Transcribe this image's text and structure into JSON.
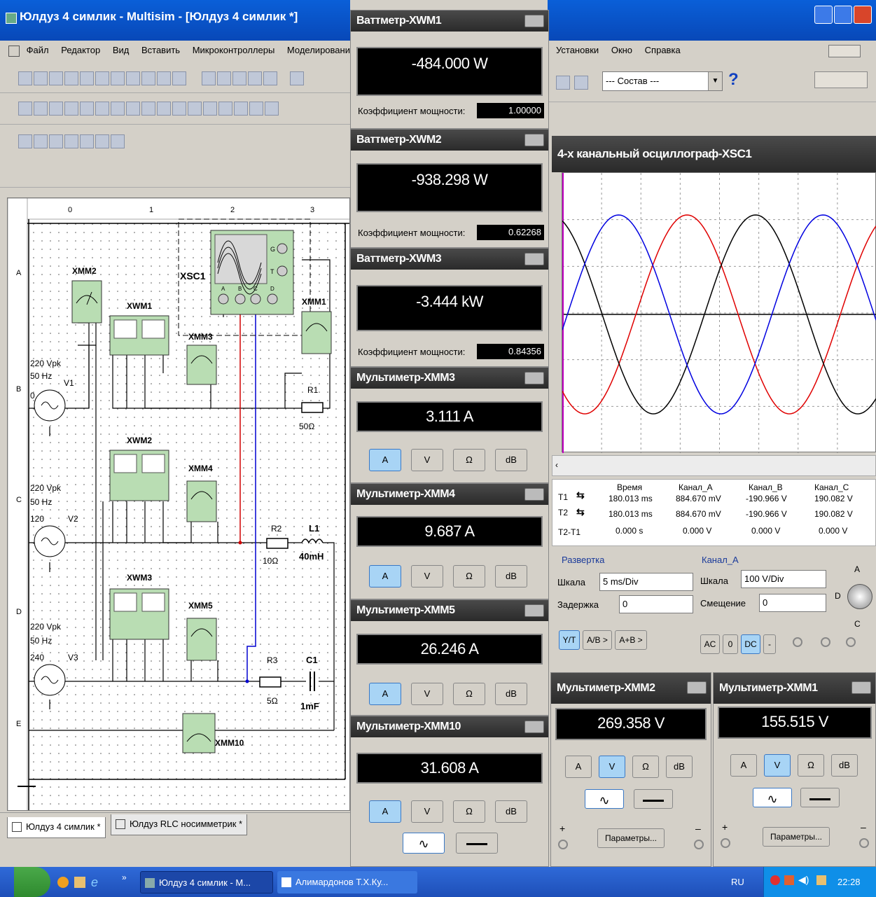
{
  "window": {
    "title": "Юлдуз 4 симлик - Multisim - [Юлдуз 4 симлик *]"
  },
  "menu": [
    "Файл",
    "Редактор",
    "Вид",
    "Вставить",
    "Микроконтроллеры",
    "Моделирования"
  ],
  "menu2": [
    "Установки",
    "Окно",
    "Справка"
  ],
  "compose_select": "--- Состав ---",
  "help_icon": "?",
  "doc_tabs": [
    "Юлдуз 4 симлик *",
    "Юлдуз RLC носимметрик *"
  ],
  "ruler": {
    "cols": [
      "0",
      "1",
      "2",
      "3"
    ],
    "rows": [
      "A",
      "B",
      "C",
      "D",
      "E"
    ]
  },
  "schematic": {
    "xmm2": "XMM2",
    "xwm1": "XWM1",
    "xsc1": "XSC1",
    "xmm1": "XMM1",
    "xmm3": "XMM3",
    "xwm2": "XWM2",
    "xmm4": "XMM4",
    "xwm3": "XWM3",
    "xmm5": "XMM5",
    "xmm10": "XMM10",
    "v1": {
      "a": "220 Vpk",
      "f": "50 Hz",
      "ph": "0",
      "name": "V1"
    },
    "v2": {
      "a": "220 Vpk",
      "f": "50 Hz",
      "ph": "120",
      "name": "V2"
    },
    "v3": {
      "a": "220 Vpk",
      "f": "50 Hz",
      "ph": "240",
      "name": "V3"
    },
    "r1": "R1",
    "r1v": "50Ω",
    "r2": "R2",
    "r2v": "10Ω",
    "l1": "L1",
    "l1v": "40mH",
    "r3": "R3",
    "r3v": "5Ω",
    "c1": "C1",
    "c1v": "1mF",
    "xsc_g": "G",
    "xsc_t": "T",
    "xsc_ch": [
      "A",
      "B",
      "C",
      "D"
    ]
  },
  "wattmeters": [
    {
      "title": "Ваттметр-XWM1",
      "value": "-484.000 W",
      "pf_label": "Коэффициент мощности:",
      "pf": "1.00000"
    },
    {
      "title": "Ваттметр-XWM2",
      "value": "-938.298 W",
      "pf_label": "Коэффициент мощности:",
      "pf": "0.62268"
    },
    {
      "title": "Ваттметр-XWM3",
      "value": "-3.444 kW",
      "pf_label": "Коэффициент мощности:",
      "pf": "0.84356"
    }
  ],
  "multimeters": [
    {
      "title": "Мультиметр-XMM3",
      "value": "3.111 A"
    },
    {
      "title": "Мультиметр-XMM4",
      "value": "9.687 A"
    },
    {
      "title": "Мультиметр-XMM5",
      "value": "26.246 A"
    },
    {
      "title": "Мультиметр-XMM10",
      "value": "31.608 A"
    }
  ],
  "mm_buttons": [
    "A",
    "V",
    "Ω",
    "dB"
  ],
  "mm_lower": [
    {
      "title": "Мультиметр-XMM2",
      "value": "269.358 V",
      "params": "Параметры..."
    },
    {
      "title": "Мультиметр-XMM1",
      "value": "155.515 V",
      "params": "Параметры..."
    }
  ],
  "mm_plus": "+",
  "mm_minus": "–",
  "scope": {
    "title": "4-х канальный осциллограф-XSC1",
    "headers": [
      "Время",
      "Канал_A",
      "Канал_B",
      "Канал_C"
    ],
    "rows": [
      {
        "label": "T1",
        "vals": [
          "180.013 ms",
          "884.670 mV",
          "-190.966 V",
          "190.082 V"
        ]
      },
      {
        "label": "T2",
        "vals": [
          "180.013 ms",
          "884.670 mV",
          "-190.966 V",
          "190.082 V"
        ]
      },
      {
        "label": "T2-T1",
        "vals": [
          "0.000 s",
          "0.000 V",
          "0.000 V",
          "0.000 V"
        ]
      }
    ],
    "sweep": {
      "label": "Развертка",
      "scale_label": "Шкала",
      "scale": "5 ms/Div",
      "delay_label": "Задержка",
      "delay": "0"
    },
    "chan": {
      "label": "Канал_A",
      "scale_label": "Шкала",
      "scale": "100 V/Div",
      "offset_label": "Смещение",
      "offset": "0"
    },
    "mode_btns": [
      "Y/T",
      "A/B >",
      "A+B >"
    ],
    "coupling_btns": [
      "AC",
      "0",
      "DC",
      "-"
    ],
    "knob_labels": [
      "A",
      "D",
      "C"
    ],
    "series": [
      {
        "name": "Канал_A",
        "color": "#e00000"
      },
      {
        "name": "Канал_B",
        "color": "#000000"
      },
      {
        "name": "Канал_C",
        "color": "#0000e0"
      }
    ]
  },
  "taskbar": {
    "items": [
      "Юлдуз 4 симлик - M...",
      "Алимардонов Т.Х.Ку..."
    ],
    "lang": "RU",
    "time": "22:28"
  }
}
